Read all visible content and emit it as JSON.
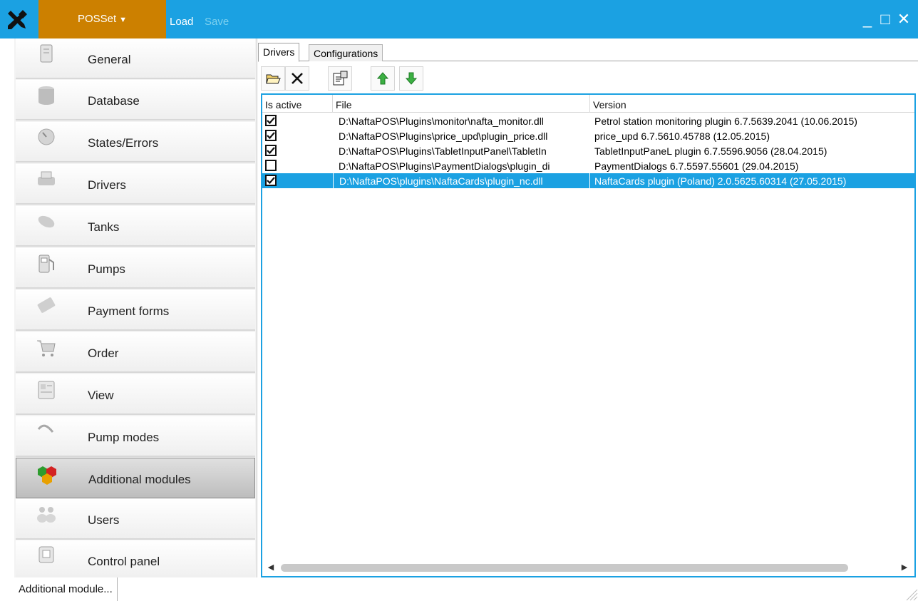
{
  "titlebar": {
    "menu_label": "POSSet",
    "load_label": "Load",
    "save_label": "Save",
    "minimize": "_",
    "maximize": "□",
    "close": "✕",
    "accent_color": "#1ba1e2",
    "menu_color": "#cc8000"
  },
  "sidebar": {
    "items": [
      {
        "label": "General",
        "icon": "document-icon"
      },
      {
        "label": "Database",
        "icon": "database-icon"
      },
      {
        "label": "States/Errors",
        "icon": "gauge-icon"
      },
      {
        "label": "Drivers",
        "icon": "printer-icon"
      },
      {
        "label": "Tanks",
        "icon": "tank-icon"
      },
      {
        "label": "Pumps",
        "icon": "fuel-pump-icon"
      },
      {
        "label": "Payment forms",
        "icon": "payment-card-icon"
      },
      {
        "label": "Order",
        "icon": "shopping-cart-icon"
      },
      {
        "label": "View",
        "icon": "view-icon"
      },
      {
        "label": "Pump modes",
        "icon": "nozzle-icon"
      },
      {
        "label": "Additional modules",
        "icon": "modules-cubes-icon",
        "selected": true
      },
      {
        "label": "Users",
        "icon": "users-icon"
      },
      {
        "label": "Control panel",
        "icon": "control-panel-icon"
      }
    ]
  },
  "main": {
    "tabs": [
      {
        "label": "Drivers",
        "active": true
      },
      {
        "label": "Configurations",
        "active": false
      }
    ],
    "toolbar": [
      "open-folder-icon",
      "delete-icon",
      "properties-icon",
      "move-up-icon",
      "move-down-icon"
    ],
    "grid": {
      "columns": [
        "Is active",
        "File",
        "Version"
      ],
      "rows": [
        {
          "active": true,
          "file": "D:\\NaftaPOS\\Plugins\\monitor\\nafta_monitor.dll",
          "version": "Petrol station monitoring plugin 6.7.5639.2041 (10.06.2015)"
        },
        {
          "active": true,
          "file": "D:\\NaftaPOS\\Plugins\\price_upd\\plugin_price.dll",
          "version": "price_upd 6.7.5610.45788 (12.05.2015)"
        },
        {
          "active": true,
          "file": "D:\\NaftaPOS\\Plugins\\TabletInputPanel\\TabletIn",
          "version": "TabletInputPaneL plugin 6.7.5596.9056 (28.04.2015)"
        },
        {
          "active": false,
          "file": "D:\\NaftaPOS\\Plugins\\PaymentDialogs\\plugin_di",
          "version": "PaymentDialogs 6.7.5597.55601 (29.04.2015)"
        },
        {
          "active": true,
          "file": "D:\\NaftaPOS\\plugins\\NaftaCards\\plugin_nc.dll",
          "version": "NaftaCards plugin (Poland) 2.0.5625.60314 (27.05.2015)",
          "selected": true
        }
      ]
    }
  },
  "statusbar": {
    "text": "Additional module..."
  }
}
